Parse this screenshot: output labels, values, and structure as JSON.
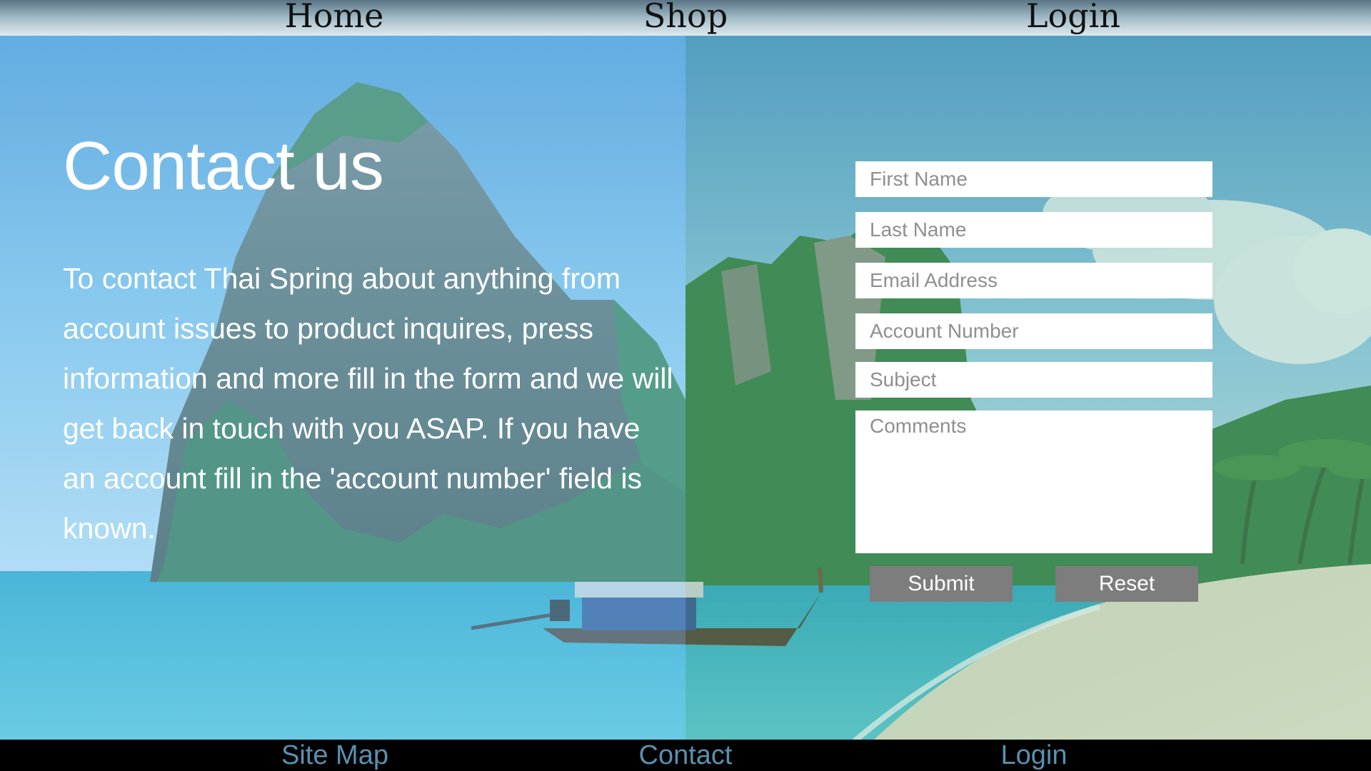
{
  "nav": {
    "items": [
      "Home",
      "Shop",
      "Login"
    ]
  },
  "main": {
    "title": "Contact us",
    "intro": "To contact Thai Spring about anything from account issues to product inquires, press information and more fill in the form and we will get back in touch with you ASAP. If you have an account fill in the 'account number' field is known."
  },
  "form": {
    "first_name_placeholder": "First Name",
    "last_name_placeholder": "Last Name",
    "email_placeholder": "Email Address",
    "account_placeholder": "Account Number",
    "subject_placeholder": "Subject",
    "comments_placeholder": "Comments",
    "submit_label": "Submit",
    "reset_label": "Reset"
  },
  "footer": {
    "items": [
      "Site Map",
      "Contact",
      "Login"
    ]
  },
  "colors": {
    "button_bg": "#7d7d7d",
    "footer_link": "#5a90b0",
    "footer_bg": "#000000"
  }
}
